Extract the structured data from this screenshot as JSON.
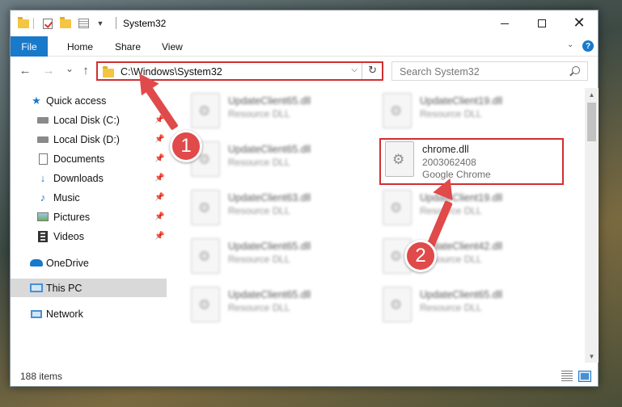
{
  "window": {
    "title": "System32",
    "controls": {
      "minimize": "minimize-icon",
      "maximize": "maximize-icon",
      "close": "✕"
    }
  },
  "ribbon": {
    "file": "File",
    "tabs": [
      "Home",
      "Share",
      "View"
    ]
  },
  "address": {
    "path": "C:\\Windows\\System32",
    "refresh_glyph": "↻",
    "dropdown_glyph": "⌵"
  },
  "search": {
    "placeholder": "Search System32"
  },
  "nav_glyphs": {
    "back": "←",
    "forward": "→",
    "recent": "⌄",
    "up": "↑"
  },
  "nav_pane": {
    "quick_access": "Quick access",
    "items": [
      {
        "label": "Local Disk (C:)",
        "icon": "drive-icon",
        "pinned": true
      },
      {
        "label": "Local Disk (D:)",
        "icon": "drive-icon",
        "pinned": true
      },
      {
        "label": "Documents",
        "icon": "documents-icon",
        "pinned": true
      },
      {
        "label": "Downloads",
        "icon": "downloads-icon",
        "pinned": true
      },
      {
        "label": "Music",
        "icon": "music-icon",
        "pinned": true
      },
      {
        "label": "Pictures",
        "icon": "pictures-icon",
        "pinned": true
      },
      {
        "label": "Videos",
        "icon": "videos-icon",
        "pinned": true
      }
    ],
    "onedrive": "OneDrive",
    "this_pc": "This PC",
    "network": "Network"
  },
  "files": {
    "left_column": [
      {
        "name": "UpdateClient65.dll",
        "type": "Resource DLL"
      },
      {
        "name": "UpdateClient65.dll",
        "type": "Resource DLL"
      },
      {
        "name": "UpdateClient63.dll",
        "type": "Resource DLL"
      },
      {
        "name": "UpdateClient65.dll",
        "type": "Resource DLL"
      },
      {
        "name": "UpdateClient65.dll",
        "type": "Resource DLL"
      }
    ],
    "right_column": [
      {
        "name": "UpdateClient19.dll",
        "type": "Resource DLL"
      },
      {
        "name": "UpdateClient19.dll",
        "type": "Resource DLL"
      },
      {
        "name": "UpdateClient42.dll",
        "type": "Resource DLL"
      },
      {
        "name": "UpdateClient65.dll",
        "type": "Resource DLL"
      }
    ],
    "highlighted": {
      "name": "chrome.dll",
      "version": "2003062408",
      "company": "Google Chrome"
    }
  },
  "status": {
    "item_count": "188 items"
  },
  "annotations": {
    "step1": "1",
    "step2": "2",
    "color": "#e04a4a"
  }
}
